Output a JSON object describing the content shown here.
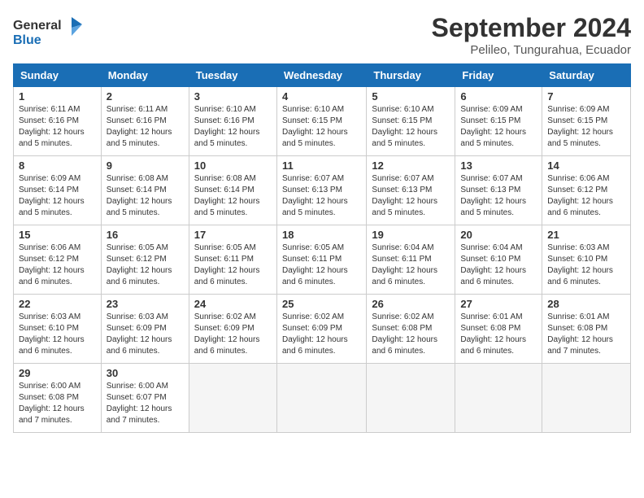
{
  "logo": {
    "general": "General",
    "blue": "Blue"
  },
  "title": "September 2024",
  "subtitle": "Pelileo, Tungurahua, Ecuador",
  "days_header": [
    "Sunday",
    "Monday",
    "Tuesday",
    "Wednesday",
    "Thursday",
    "Friday",
    "Saturday"
  ],
  "weeks": [
    [
      {
        "num": "1",
        "info": "Sunrise: 6:11 AM\nSunset: 6:16 PM\nDaylight: 12 hours\nand 5 minutes."
      },
      {
        "num": "2",
        "info": "Sunrise: 6:11 AM\nSunset: 6:16 PM\nDaylight: 12 hours\nand 5 minutes."
      },
      {
        "num": "3",
        "info": "Sunrise: 6:10 AM\nSunset: 6:16 PM\nDaylight: 12 hours\nand 5 minutes."
      },
      {
        "num": "4",
        "info": "Sunrise: 6:10 AM\nSunset: 6:15 PM\nDaylight: 12 hours\nand 5 minutes."
      },
      {
        "num": "5",
        "info": "Sunrise: 6:10 AM\nSunset: 6:15 PM\nDaylight: 12 hours\nand 5 minutes."
      },
      {
        "num": "6",
        "info": "Sunrise: 6:09 AM\nSunset: 6:15 PM\nDaylight: 12 hours\nand 5 minutes."
      },
      {
        "num": "7",
        "info": "Sunrise: 6:09 AM\nSunset: 6:15 PM\nDaylight: 12 hours\nand 5 minutes."
      }
    ],
    [
      {
        "num": "8",
        "info": "Sunrise: 6:09 AM\nSunset: 6:14 PM\nDaylight: 12 hours\nand 5 minutes."
      },
      {
        "num": "9",
        "info": "Sunrise: 6:08 AM\nSunset: 6:14 PM\nDaylight: 12 hours\nand 5 minutes."
      },
      {
        "num": "10",
        "info": "Sunrise: 6:08 AM\nSunset: 6:14 PM\nDaylight: 12 hours\nand 5 minutes."
      },
      {
        "num": "11",
        "info": "Sunrise: 6:07 AM\nSunset: 6:13 PM\nDaylight: 12 hours\nand 5 minutes."
      },
      {
        "num": "12",
        "info": "Sunrise: 6:07 AM\nSunset: 6:13 PM\nDaylight: 12 hours\nand 5 minutes."
      },
      {
        "num": "13",
        "info": "Sunrise: 6:07 AM\nSunset: 6:13 PM\nDaylight: 12 hours\nand 5 minutes."
      },
      {
        "num": "14",
        "info": "Sunrise: 6:06 AM\nSunset: 6:12 PM\nDaylight: 12 hours\nand 6 minutes."
      }
    ],
    [
      {
        "num": "15",
        "info": "Sunrise: 6:06 AM\nSunset: 6:12 PM\nDaylight: 12 hours\nand 6 minutes."
      },
      {
        "num": "16",
        "info": "Sunrise: 6:05 AM\nSunset: 6:12 PM\nDaylight: 12 hours\nand 6 minutes."
      },
      {
        "num": "17",
        "info": "Sunrise: 6:05 AM\nSunset: 6:11 PM\nDaylight: 12 hours\nand 6 minutes."
      },
      {
        "num": "18",
        "info": "Sunrise: 6:05 AM\nSunset: 6:11 PM\nDaylight: 12 hours\nand 6 minutes."
      },
      {
        "num": "19",
        "info": "Sunrise: 6:04 AM\nSunset: 6:11 PM\nDaylight: 12 hours\nand 6 minutes."
      },
      {
        "num": "20",
        "info": "Sunrise: 6:04 AM\nSunset: 6:10 PM\nDaylight: 12 hours\nand 6 minutes."
      },
      {
        "num": "21",
        "info": "Sunrise: 6:03 AM\nSunset: 6:10 PM\nDaylight: 12 hours\nand 6 minutes."
      }
    ],
    [
      {
        "num": "22",
        "info": "Sunrise: 6:03 AM\nSunset: 6:10 PM\nDaylight: 12 hours\nand 6 minutes."
      },
      {
        "num": "23",
        "info": "Sunrise: 6:03 AM\nSunset: 6:09 PM\nDaylight: 12 hours\nand 6 minutes."
      },
      {
        "num": "24",
        "info": "Sunrise: 6:02 AM\nSunset: 6:09 PM\nDaylight: 12 hours\nand 6 minutes."
      },
      {
        "num": "25",
        "info": "Sunrise: 6:02 AM\nSunset: 6:09 PM\nDaylight: 12 hours\nand 6 minutes."
      },
      {
        "num": "26",
        "info": "Sunrise: 6:02 AM\nSunset: 6:08 PM\nDaylight: 12 hours\nand 6 minutes."
      },
      {
        "num": "27",
        "info": "Sunrise: 6:01 AM\nSunset: 6:08 PM\nDaylight: 12 hours\nand 6 minutes."
      },
      {
        "num": "28",
        "info": "Sunrise: 6:01 AM\nSunset: 6:08 PM\nDaylight: 12 hours\nand 7 minutes."
      }
    ],
    [
      {
        "num": "29",
        "info": "Sunrise: 6:00 AM\nSunset: 6:08 PM\nDaylight: 12 hours\nand 7 minutes."
      },
      {
        "num": "30",
        "info": "Sunrise: 6:00 AM\nSunset: 6:07 PM\nDaylight: 12 hours\nand 7 minutes."
      },
      null,
      null,
      null,
      null,
      null
    ]
  ]
}
